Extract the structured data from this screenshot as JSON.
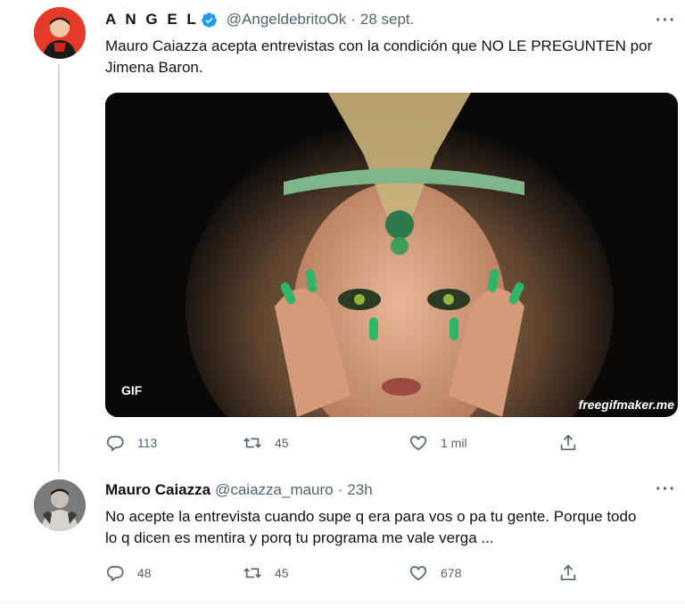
{
  "tweets": [
    {
      "author": {
        "name": "A N G E L",
        "handle": "@AngeldebritoOk",
        "verified": true
      },
      "sep": "·",
      "time": "28 sept.",
      "text": "Mauro Caiazza acepta entrevistas con la condición que NO LE PREGUNTEN por Jimena Baron.",
      "media": {
        "badge": "GIF",
        "watermark": "freegifmaker.me"
      },
      "stats": {
        "replies": "113",
        "retweets": "45",
        "likes": "1 mil"
      }
    },
    {
      "author": {
        "name": "Mauro Caiazza",
        "handle": "@caiazza_mauro",
        "verified": false
      },
      "sep": "·",
      "time": "23h",
      "text": "No acepte la entrevista cuando supe q era para vos o pa tu gente. Porque todo lo q dicen es mentira y porq tu programa me vale verga ...",
      "stats": {
        "replies": "48",
        "retweets": "45",
        "likes": "678"
      }
    }
  ],
  "icons": {
    "more": "more-horizontal-icon",
    "reply": "reply-icon",
    "retweet": "retweet-icon",
    "like": "heart-icon",
    "share": "share-icon",
    "verified": "verified-badge-icon"
  },
  "colors": {
    "verified": "#1d9bf0",
    "muted": "#536471",
    "text": "#0f1419"
  }
}
